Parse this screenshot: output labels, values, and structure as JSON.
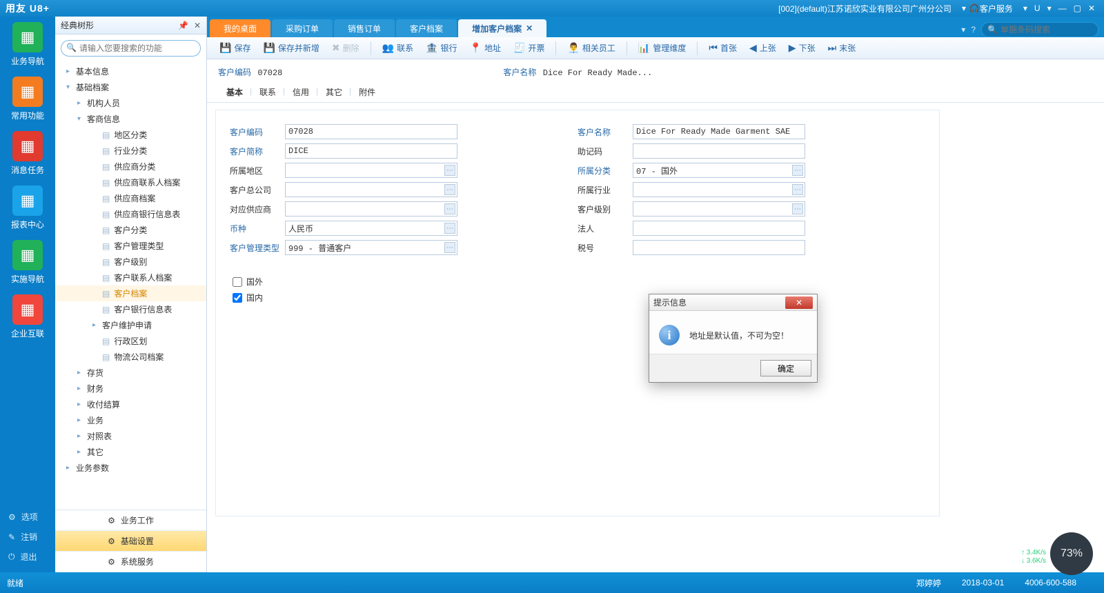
{
  "titlebar": {
    "logo": "用友 U8+",
    "company": "[002](default)江苏诺欣实业有限公司广州分公司",
    "service": "客户服务",
    "u_icon": "U"
  },
  "leftrail": {
    "items": [
      {
        "label": "业务导航",
        "bg": "#20b159"
      },
      {
        "label": "常用功能",
        "bg": "#f37c20"
      },
      {
        "label": "消息任务",
        "bg": "#e13a2e"
      },
      {
        "label": "报表中心",
        "bg": "#1aa3e8"
      },
      {
        "label": "实施导航",
        "bg": "#20b159"
      },
      {
        "label": "企业互联",
        "bg": "#f0463b"
      }
    ],
    "bottom": [
      {
        "icon": "⚙",
        "label": "选项"
      },
      {
        "icon": "✎",
        "label": "注销"
      },
      {
        "icon": "⏻",
        "label": "退出"
      }
    ]
  },
  "treepanel": {
    "title": "经典树形",
    "placeholder": "请输入您要搜索的功能",
    "nodes": [
      {
        "lvl": 1,
        "arw": "▸",
        "label": "基本信息"
      },
      {
        "lvl": 1,
        "arw": "▾",
        "label": "基础档案"
      },
      {
        "lvl": 2,
        "arw": "▸",
        "label": "机构人员"
      },
      {
        "lvl": 2,
        "arw": "▾",
        "label": "客商信息"
      },
      {
        "lvl": 3,
        "arw": "",
        "label": "地区分类",
        "leaf": true
      },
      {
        "lvl": 3,
        "arw": "",
        "label": "行业分类",
        "leaf": true
      },
      {
        "lvl": 3,
        "arw": "",
        "label": "供应商分类",
        "leaf": true
      },
      {
        "lvl": 3,
        "arw": "",
        "label": "供应商联系人档案",
        "leaf": true
      },
      {
        "lvl": 3,
        "arw": "",
        "label": "供应商档案",
        "leaf": true
      },
      {
        "lvl": 3,
        "arw": "",
        "label": "供应商银行信息表",
        "leaf": true
      },
      {
        "lvl": 3,
        "arw": "",
        "label": "客户分类",
        "leaf": true
      },
      {
        "lvl": 3,
        "arw": "",
        "label": "客户管理类型",
        "leaf": true
      },
      {
        "lvl": 3,
        "arw": "",
        "label": "客户级别",
        "leaf": true
      },
      {
        "lvl": 3,
        "arw": "",
        "label": "客户联系人档案",
        "leaf": true
      },
      {
        "lvl": 3,
        "arw": "",
        "label": "客户档案",
        "leaf": true,
        "sel": true
      },
      {
        "lvl": 3,
        "arw": "",
        "label": "客户银行信息表",
        "leaf": true
      },
      {
        "lvl": 3,
        "arw": "▸",
        "label": "客户维护申请"
      },
      {
        "lvl": 3,
        "arw": "",
        "label": "行政区划",
        "leaf": true
      },
      {
        "lvl": 3,
        "arw": "",
        "label": "物流公司档案",
        "leaf": true
      },
      {
        "lvl": 2,
        "arw": "▸",
        "label": "存货"
      },
      {
        "lvl": 2,
        "arw": "▸",
        "label": "财务"
      },
      {
        "lvl": 2,
        "arw": "▸",
        "label": "收付结算"
      },
      {
        "lvl": 2,
        "arw": "▸",
        "label": "业务"
      },
      {
        "lvl": 2,
        "arw": "▸",
        "label": "对照表"
      },
      {
        "lvl": 2,
        "arw": "▸",
        "label": "其它"
      },
      {
        "lvl": 1,
        "arw": "▸",
        "label": "业务参数"
      }
    ],
    "bottom": [
      {
        "label": "业务工作",
        "active": false
      },
      {
        "label": "基础设置",
        "active": true
      },
      {
        "label": "系统服务",
        "active": false
      }
    ]
  },
  "tabs": {
    "items": [
      {
        "label": "我的桌面",
        "cls": "home"
      },
      {
        "label": "采购订单"
      },
      {
        "label": "销售订单"
      },
      {
        "label": "客户档案"
      },
      {
        "label": "增加客户档案",
        "active": true,
        "closable": true
      }
    ],
    "search_placeholder": "单据条码搜索"
  },
  "toolbar": {
    "items": [
      {
        "icon": "💾",
        "label": "保存"
      },
      {
        "icon": "💾",
        "label": "保存并新增"
      },
      {
        "icon": "✖",
        "label": "删除",
        "disabled": true,
        "sep": true
      },
      {
        "icon": "👥",
        "label": "联系"
      },
      {
        "icon": "🏦",
        "label": "银行"
      },
      {
        "icon": "📍",
        "label": "地址"
      },
      {
        "icon": "🧾",
        "label": "开票",
        "sep": true
      },
      {
        "icon": "👨‍💼",
        "label": "相关员工",
        "sep": true
      },
      {
        "icon": "📊",
        "label": "管理维度",
        "sep": true
      },
      {
        "icon": "⏮",
        "label": "首张"
      },
      {
        "icon": "◀",
        "label": "上张"
      },
      {
        "icon": "▶",
        "label": "下张"
      },
      {
        "icon": "⏭",
        "label": "末张"
      }
    ]
  },
  "header": {
    "code_label": "客户编码",
    "code_value": "07028",
    "name_label": "客户名称",
    "name_value": "Dice For Ready Made..."
  },
  "subtabs": [
    "基本",
    "联系",
    "信用",
    "其它",
    "附件"
  ],
  "form": {
    "rows": [
      [
        {
          "label": "客户编码",
          "value": "07028",
          "hl": true
        },
        {
          "label": "客户名称",
          "value": "Dice For Ready Made Garment SAE",
          "hl": true
        }
      ],
      [
        {
          "label": "客户简称",
          "value": "DICE",
          "hl": true
        },
        {
          "label": "助记码",
          "value": ""
        }
      ],
      [
        {
          "label": "所属地区",
          "value": "",
          "lk": true
        },
        {
          "label": "所属分类",
          "value": "07 - 国外",
          "lk": true,
          "hl": true
        }
      ],
      [
        {
          "label": "客户总公司",
          "value": "",
          "lk": true
        },
        {
          "label": "所属行业",
          "value": "",
          "lk": true
        }
      ],
      [
        {
          "label": "对应供应商",
          "value": "",
          "lk": true
        },
        {
          "label": "客户级别",
          "value": "",
          "lk": true
        }
      ],
      [
        {
          "label": "币种",
          "value": "人民币",
          "lk": true,
          "hl": true
        },
        {
          "label": "法人",
          "value": ""
        }
      ],
      [
        {
          "label": "客户管理类型",
          "value": "999 - 普通客户",
          "lk": true,
          "hl": true
        },
        {
          "label": "税号",
          "value": ""
        }
      ]
    ],
    "checks": [
      {
        "label": "国外",
        "checked": false
      },
      {
        "label": "国内",
        "checked": true
      }
    ]
  },
  "dialog": {
    "title": "提示信息",
    "message": "地址是默认值，不可为空！",
    "ok": "确定"
  },
  "statusbar": {
    "ready": "就绪",
    "user": "郑婷婷",
    "date": "2018-03-01",
    "phone": "4006-600-588"
  },
  "net": {
    "up": "↑ 3.4K/s",
    "dn": "↓ 3.6K/s",
    "pct": "73%"
  }
}
